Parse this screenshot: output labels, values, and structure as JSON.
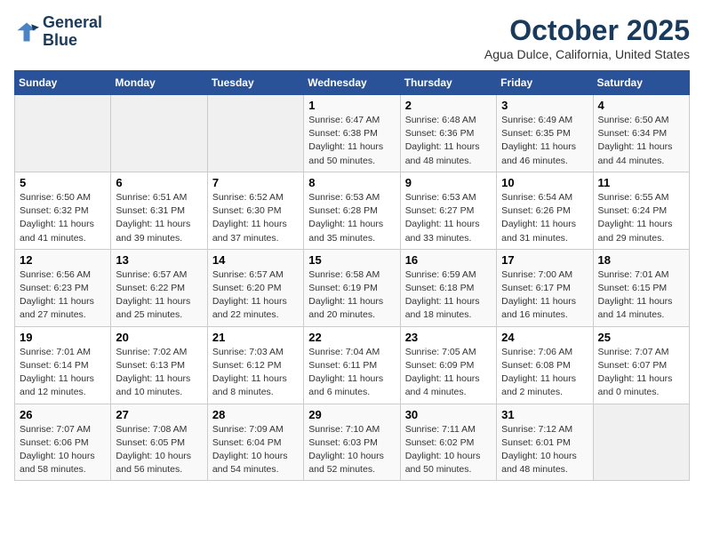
{
  "header": {
    "logo_line1": "General",
    "logo_line2": "Blue",
    "month": "October 2025",
    "location": "Agua Dulce, California, United States"
  },
  "weekdays": [
    "Sunday",
    "Monday",
    "Tuesday",
    "Wednesday",
    "Thursday",
    "Friday",
    "Saturday"
  ],
  "weeks": [
    [
      {
        "day": "",
        "info": ""
      },
      {
        "day": "",
        "info": ""
      },
      {
        "day": "",
        "info": ""
      },
      {
        "day": "1",
        "info": "Sunrise: 6:47 AM\nSunset: 6:38 PM\nDaylight: 11 hours and 50 minutes."
      },
      {
        "day": "2",
        "info": "Sunrise: 6:48 AM\nSunset: 6:36 PM\nDaylight: 11 hours and 48 minutes."
      },
      {
        "day": "3",
        "info": "Sunrise: 6:49 AM\nSunset: 6:35 PM\nDaylight: 11 hours and 46 minutes."
      },
      {
        "day": "4",
        "info": "Sunrise: 6:50 AM\nSunset: 6:34 PM\nDaylight: 11 hours and 44 minutes."
      }
    ],
    [
      {
        "day": "5",
        "info": "Sunrise: 6:50 AM\nSunset: 6:32 PM\nDaylight: 11 hours and 41 minutes."
      },
      {
        "day": "6",
        "info": "Sunrise: 6:51 AM\nSunset: 6:31 PM\nDaylight: 11 hours and 39 minutes."
      },
      {
        "day": "7",
        "info": "Sunrise: 6:52 AM\nSunset: 6:30 PM\nDaylight: 11 hours and 37 minutes."
      },
      {
        "day": "8",
        "info": "Sunrise: 6:53 AM\nSunset: 6:28 PM\nDaylight: 11 hours and 35 minutes."
      },
      {
        "day": "9",
        "info": "Sunrise: 6:53 AM\nSunset: 6:27 PM\nDaylight: 11 hours and 33 minutes."
      },
      {
        "day": "10",
        "info": "Sunrise: 6:54 AM\nSunset: 6:26 PM\nDaylight: 11 hours and 31 minutes."
      },
      {
        "day": "11",
        "info": "Sunrise: 6:55 AM\nSunset: 6:24 PM\nDaylight: 11 hours and 29 minutes."
      }
    ],
    [
      {
        "day": "12",
        "info": "Sunrise: 6:56 AM\nSunset: 6:23 PM\nDaylight: 11 hours and 27 minutes."
      },
      {
        "day": "13",
        "info": "Sunrise: 6:57 AM\nSunset: 6:22 PM\nDaylight: 11 hours and 25 minutes."
      },
      {
        "day": "14",
        "info": "Sunrise: 6:57 AM\nSunset: 6:20 PM\nDaylight: 11 hours and 22 minutes."
      },
      {
        "day": "15",
        "info": "Sunrise: 6:58 AM\nSunset: 6:19 PM\nDaylight: 11 hours and 20 minutes."
      },
      {
        "day": "16",
        "info": "Sunrise: 6:59 AM\nSunset: 6:18 PM\nDaylight: 11 hours and 18 minutes."
      },
      {
        "day": "17",
        "info": "Sunrise: 7:00 AM\nSunset: 6:17 PM\nDaylight: 11 hours and 16 minutes."
      },
      {
        "day": "18",
        "info": "Sunrise: 7:01 AM\nSunset: 6:15 PM\nDaylight: 11 hours and 14 minutes."
      }
    ],
    [
      {
        "day": "19",
        "info": "Sunrise: 7:01 AM\nSunset: 6:14 PM\nDaylight: 11 hours and 12 minutes."
      },
      {
        "day": "20",
        "info": "Sunrise: 7:02 AM\nSunset: 6:13 PM\nDaylight: 11 hours and 10 minutes."
      },
      {
        "day": "21",
        "info": "Sunrise: 7:03 AM\nSunset: 6:12 PM\nDaylight: 11 hours and 8 minutes."
      },
      {
        "day": "22",
        "info": "Sunrise: 7:04 AM\nSunset: 6:11 PM\nDaylight: 11 hours and 6 minutes."
      },
      {
        "day": "23",
        "info": "Sunrise: 7:05 AM\nSunset: 6:09 PM\nDaylight: 11 hours and 4 minutes."
      },
      {
        "day": "24",
        "info": "Sunrise: 7:06 AM\nSunset: 6:08 PM\nDaylight: 11 hours and 2 minutes."
      },
      {
        "day": "25",
        "info": "Sunrise: 7:07 AM\nSunset: 6:07 PM\nDaylight: 11 hours and 0 minutes."
      }
    ],
    [
      {
        "day": "26",
        "info": "Sunrise: 7:07 AM\nSunset: 6:06 PM\nDaylight: 10 hours and 58 minutes."
      },
      {
        "day": "27",
        "info": "Sunrise: 7:08 AM\nSunset: 6:05 PM\nDaylight: 10 hours and 56 minutes."
      },
      {
        "day": "28",
        "info": "Sunrise: 7:09 AM\nSunset: 6:04 PM\nDaylight: 10 hours and 54 minutes."
      },
      {
        "day": "29",
        "info": "Sunrise: 7:10 AM\nSunset: 6:03 PM\nDaylight: 10 hours and 52 minutes."
      },
      {
        "day": "30",
        "info": "Sunrise: 7:11 AM\nSunset: 6:02 PM\nDaylight: 10 hours and 50 minutes."
      },
      {
        "day": "31",
        "info": "Sunrise: 7:12 AM\nSunset: 6:01 PM\nDaylight: 10 hours and 48 minutes."
      },
      {
        "day": "",
        "info": ""
      }
    ]
  ]
}
